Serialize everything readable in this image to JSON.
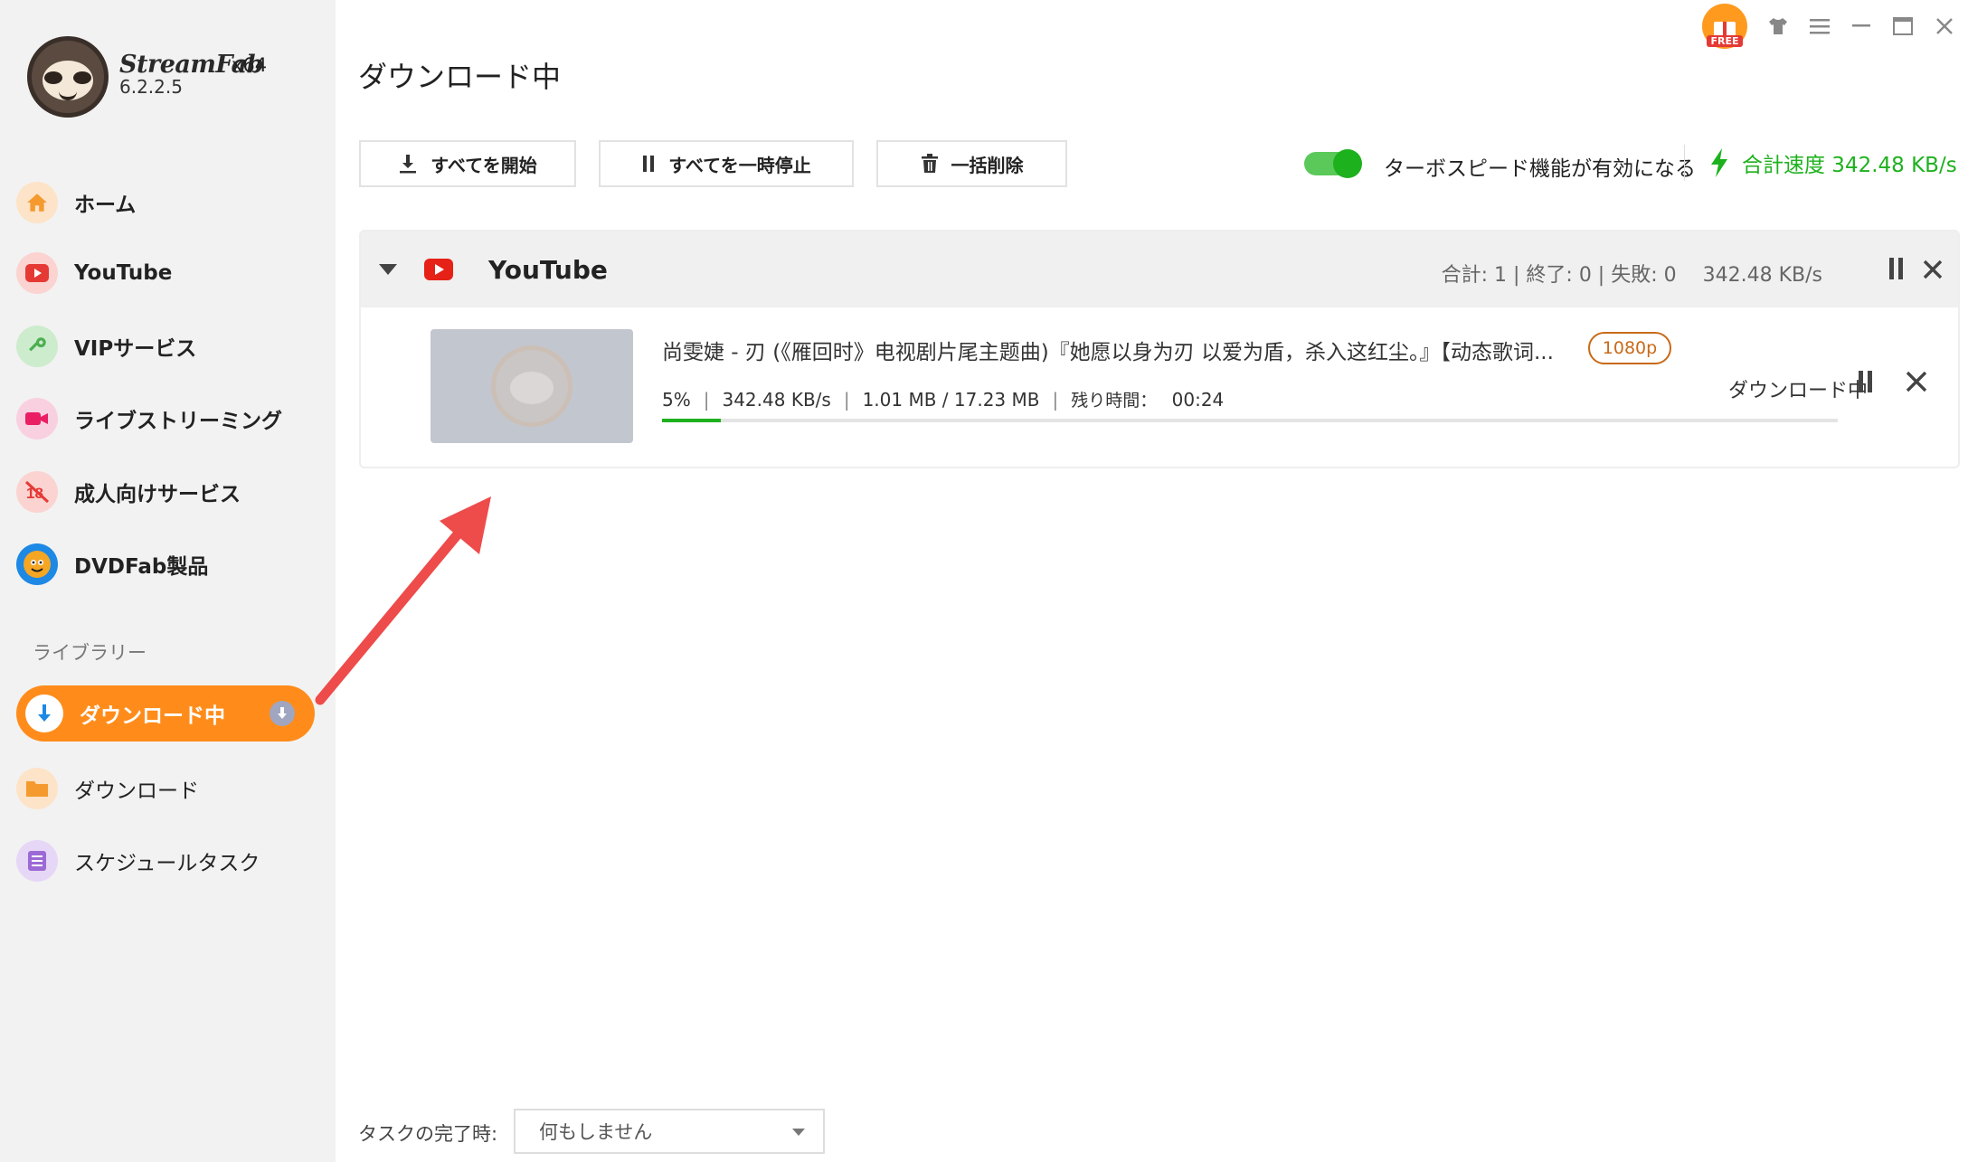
{
  "app": {
    "name": "StreamFab",
    "arch": "x64",
    "version": "6.2.2.5"
  },
  "window_controls": {
    "free_label": "FREE"
  },
  "sidebar": {
    "items": [
      {
        "label": "ホーム",
        "icon": "home-icon",
        "color": "#f59a2e"
      },
      {
        "label": "YouTube",
        "icon": "youtube-icon",
        "color": "#e53935"
      },
      {
        "label": "VIPサービス",
        "icon": "key-icon",
        "color": "#4caf50"
      },
      {
        "label": "ライブストリーミング",
        "icon": "camera-icon",
        "color": "#e91e63"
      },
      {
        "label": "成人向けサービス",
        "icon": "eighteen-plus-icon",
        "color": "#e53935"
      },
      {
        "label": "DVDFab製品",
        "icon": "dvdfab-icon",
        "color": "#1e88e5"
      }
    ],
    "library_title": "ライブラリー",
    "library": [
      {
        "label": "ダウンロード中",
        "icon": "download-arrow-icon",
        "active": true
      },
      {
        "label": "ダウンロード",
        "icon": "folder-icon",
        "color": "#f59a2e"
      },
      {
        "label": "スケジュールタスク",
        "icon": "schedule-list-icon",
        "color": "#9c6ad4"
      }
    ]
  },
  "main": {
    "title": "ダウンロード中",
    "toolbar": {
      "start_all": "すべてを開始",
      "pause_all": "すべてを一時停止",
      "delete_all": "一括削除",
      "turbo_label": "ターボスピード機能が有効になる",
      "turbo_enabled": true,
      "total_speed": "合計速度 342.48 KB/s"
    },
    "group": {
      "name": "YouTube",
      "stats": "合計: 1 | 終了: 0 | 失敗: 0",
      "speed": "342.48 KB/s",
      "item": {
        "title": "尚雯婕 - 刃 (《雁回时》电视剧片尾主题曲)『她愿以身为刃 以爱为盾，杀入这红尘。』【动态歌词...",
        "quality": "1080p",
        "percent": "5%",
        "percent_value": 0.05,
        "speed": "342.48 KB/s",
        "size": "1.01 MB / 17.23 MB",
        "remaining_label": "残り時間：",
        "remaining": "00:24",
        "status": "ダウンロード中"
      }
    },
    "footer": {
      "label": "タスクの完了時:",
      "select_value": "何もしません"
    }
  },
  "colors": {
    "accent": "#ff8c1a",
    "speed_green": "#1eb11e",
    "quality_border": "#c86a19"
  }
}
